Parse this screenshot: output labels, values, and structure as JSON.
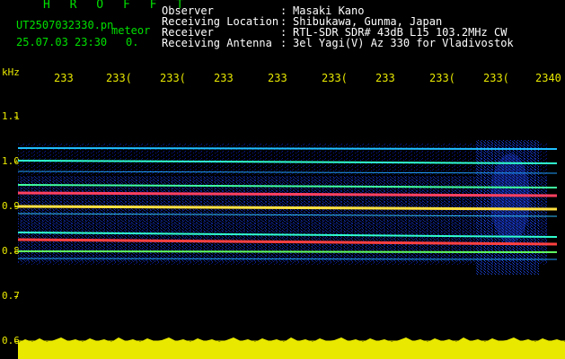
{
  "header": {
    "app_name": "H R O F F T",
    "filename": "UT2507032330.pn",
    "mode": "meteor",
    "datetime": "25.07.03 23:30",
    "counter": "0.",
    "info": [
      {
        "key": "Observer",
        "value": "Masaki Kano"
      },
      {
        "key": "Receiving Location",
        "value": "Shibukawa, Gunma, Japan"
      },
      {
        "key": "Receiver",
        "value": "RTL-SDR SDR# 43dB L15 103.2MHz CW"
      },
      {
        "key": "Receiving Antenna",
        "value": "3el Yagi(V) Az 330 for Vladivostok"
      }
    ]
  },
  "axis": {
    "unit": "kHz",
    "x_ticks": [
      "233",
      "233(",
      "233(",
      "233",
      "233",
      "233(",
      "233",
      "233(",
      "233(",
      "2340"
    ],
    "y_ticks": [
      "1.1",
      "1.0",
      "0.9",
      "0.8",
      "0.7",
      "0.6"
    ]
  },
  "colors": {
    "label_green": "#00e000",
    "axis_yellow": "#e8e800",
    "info_white": "#ffffff"
  }
}
